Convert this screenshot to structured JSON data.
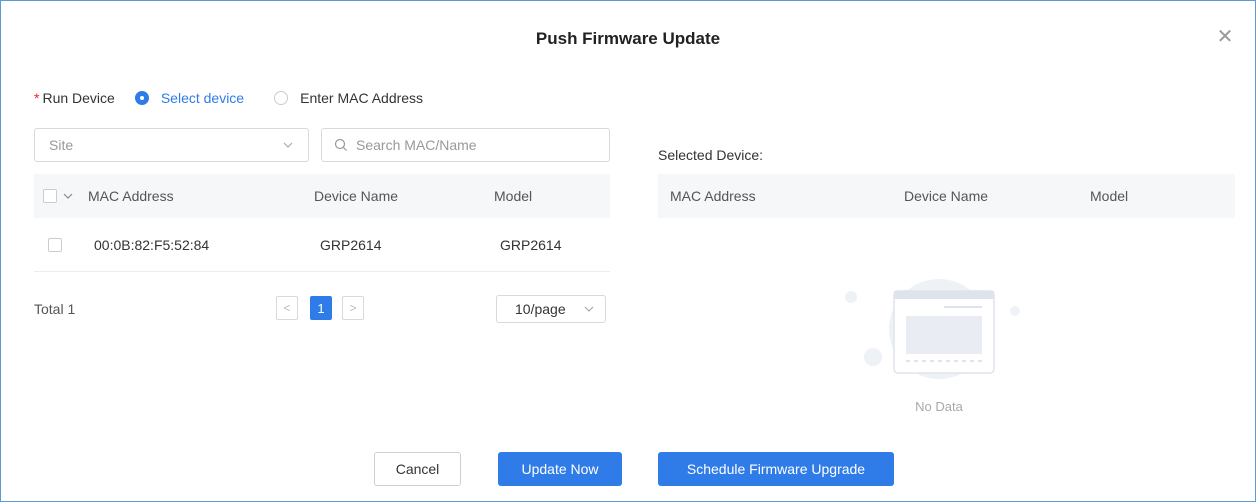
{
  "dialog": {
    "title": "Push Firmware Update",
    "close_icon": "close-icon"
  },
  "run_device": {
    "required_mark": "*",
    "label": "Run Device",
    "options": [
      {
        "label": "Select device",
        "selected": true
      },
      {
        "label": "Enter MAC Address",
        "selected": false
      }
    ]
  },
  "filters": {
    "site_placeholder": "Site",
    "search_placeholder": "Search MAC/Name"
  },
  "left_table": {
    "columns": [
      "MAC Address",
      "Device Name",
      "Model"
    ],
    "rows": [
      {
        "mac": "00:0B:82:F5:52:84",
        "name": "GRP2614",
        "model": "GRP2614",
        "checked": false
      }
    ]
  },
  "pagination": {
    "total": "Total 1",
    "current_page": "1",
    "page_size": "10/page"
  },
  "right_panel": {
    "label": "Selected Device:",
    "columns": [
      "MAC Address",
      "Device Name",
      "Model"
    ],
    "empty_text": "No Data"
  },
  "footer": {
    "cancel": "Cancel",
    "update_now": "Update Now",
    "schedule": "Schedule Firmware Upgrade"
  },
  "colors": {
    "accent": "#2f7ce8",
    "required": "#f5222d",
    "header_bg": "#f6f7f9",
    "dialog_border": "#5b9bd5"
  }
}
